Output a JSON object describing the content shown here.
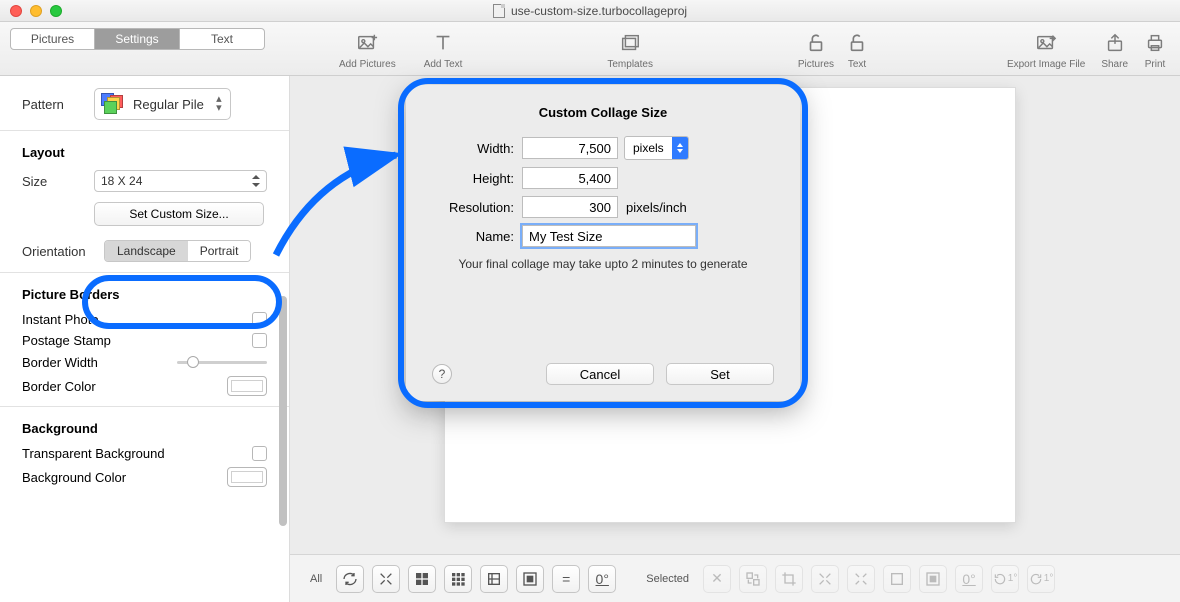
{
  "window": {
    "filename": "use-custom-size.turbocollageproj"
  },
  "tabs": {
    "pictures": "Pictures",
    "settings": "Settings",
    "text": "Text",
    "selected": "settings"
  },
  "toolbar": {
    "add_pictures": "Add Pictures",
    "add_text": "Add Text",
    "templates": "Templates",
    "lock_pictures": "Pictures",
    "lock_text": "Text",
    "export": "Export Image File",
    "share": "Share",
    "print": "Print"
  },
  "sidebar": {
    "pattern_label": "Pattern",
    "pattern_value": "Regular Pile",
    "layout_title": "Layout",
    "size_label": "Size",
    "size_value": "18 X 24",
    "set_custom": "Set Custom Size...",
    "orientation_label": "Orientation",
    "orientation": {
      "landscape": "Landscape",
      "portrait": "Portrait",
      "selected": "landscape"
    },
    "borders_title": "Picture Borders",
    "instant_photo": "Instant Photo",
    "postage_stamp": "Postage Stamp",
    "border_width": "Border Width",
    "border_color": "Border Color",
    "background_title": "Background",
    "transparent_bg": "Transparent Background",
    "background_color": "Background Color"
  },
  "modal": {
    "title": "Custom Collage Size",
    "width_label": "Width:",
    "width_value": "7,500",
    "height_label": "Height:",
    "height_value": "5,400",
    "resolution_label": "Resolution:",
    "resolution_value": "300",
    "unit": "pixels",
    "res_unit": "pixels/inch",
    "name_label": "Name:",
    "name_value": "My Test Size",
    "hint": "Your final collage may take upto 2 minutes to generate",
    "cancel": "Cancel",
    "set": "Set",
    "help": "?"
  },
  "bottombar": {
    "all": "All",
    "selected": "Selected",
    "angle": "0°",
    "r1": "1°",
    "r2": "1°"
  }
}
